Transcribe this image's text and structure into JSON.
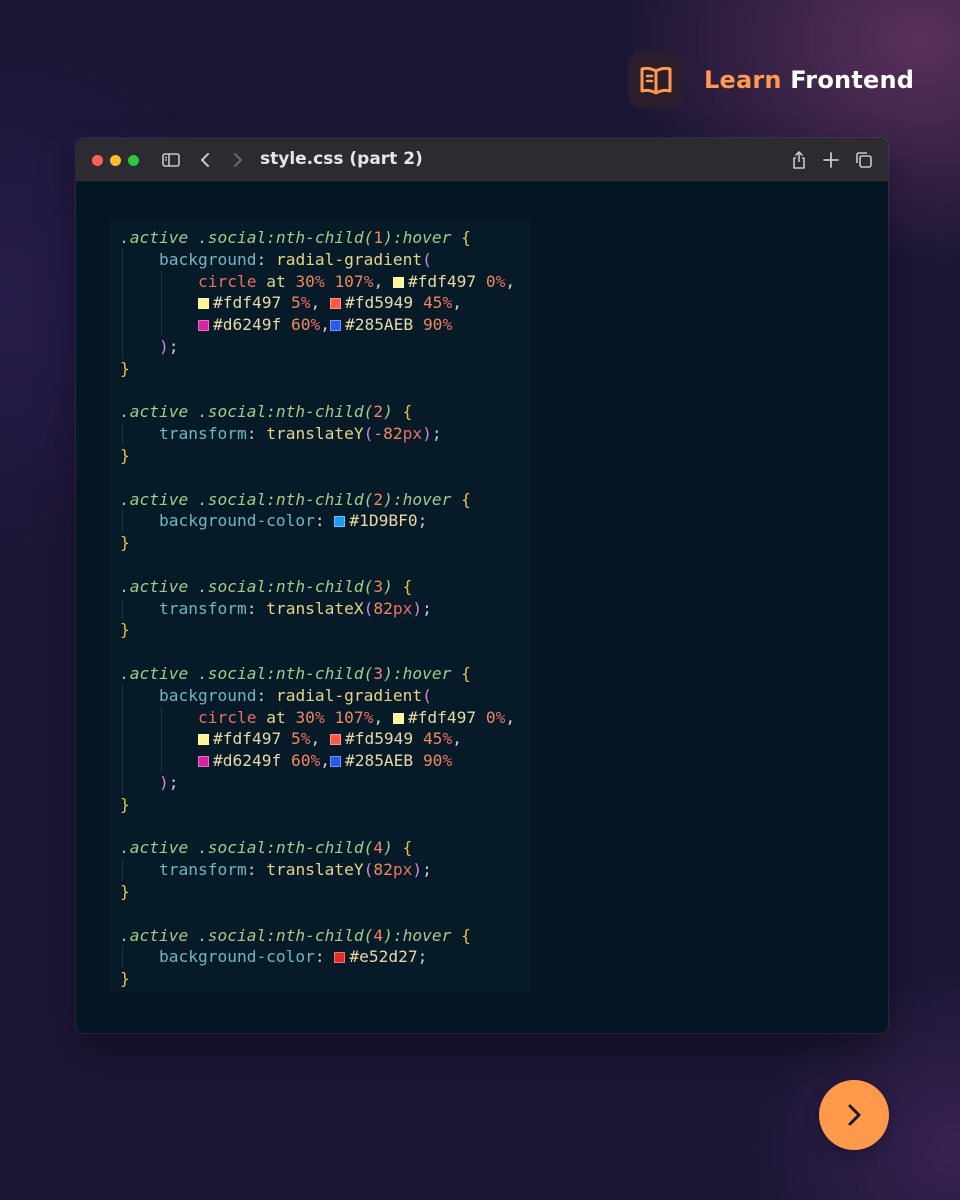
{
  "brand": {
    "name_part1": "Learn",
    "name_part2": "Frontend",
    "logo_icon": "open-book-icon",
    "accent_color": "#ff9a4d"
  },
  "window": {
    "title": "style.css (part 2)",
    "toolbar_icons": [
      "sidebar-icon",
      "back-chevron-icon",
      "forward-chevron-icon",
      "share-icon",
      "plus-icon",
      "copy-tabs-icon"
    ]
  },
  "code": [
    [
      {
        "c": "sel",
        "t": ".active .social:nth-child("
      },
      {
        "c": "num",
        "t": "1"
      },
      {
        "c": "sel",
        "t": "):hover "
      },
      {
        "c": "br",
        "t": "{"
      }
    ],
    [
      {
        "c": "ind",
        "t": "    "
      },
      {
        "c": "prop",
        "t": "background"
      },
      {
        "c": "punc",
        "t": ": "
      },
      {
        "c": "fn",
        "t": "radial-gradient"
      },
      {
        "c": "par",
        "t": "("
      }
    ],
    [
      {
        "c": "ind",
        "t": "        "
      },
      {
        "c": "kw",
        "t": "circle"
      },
      {
        "c": "fn",
        "t": " at "
      },
      {
        "c": "num",
        "t": "30"
      },
      {
        "c": "unit",
        "t": "%"
      },
      {
        "c": "punc",
        "t": " "
      },
      {
        "c": "num",
        "t": "107"
      },
      {
        "c": "unit",
        "t": "%"
      },
      {
        "c": "punc",
        "t": ", "
      },
      {
        "c": "hex",
        "t": "#fdf497",
        "sw": "#fdf497"
      },
      {
        "c": "punc",
        "t": " "
      },
      {
        "c": "num",
        "t": "0"
      },
      {
        "c": "unit",
        "t": "%"
      },
      {
        "c": "punc",
        "t": ","
      }
    ],
    [
      {
        "c": "ind",
        "t": "        "
      },
      {
        "c": "hex",
        "t": "#fdf497",
        "sw": "#fdf497"
      },
      {
        "c": "punc",
        "t": " "
      },
      {
        "c": "num",
        "t": "5"
      },
      {
        "c": "unit",
        "t": "%"
      },
      {
        "c": "punc",
        "t": ", "
      },
      {
        "c": "hex",
        "t": "#fd5949",
        "sw": "#fd5949"
      },
      {
        "c": "punc",
        "t": " "
      },
      {
        "c": "num",
        "t": "45"
      },
      {
        "c": "unit",
        "t": "%"
      },
      {
        "c": "punc",
        "t": ","
      }
    ],
    [
      {
        "c": "ind",
        "t": "        "
      },
      {
        "c": "hex",
        "t": "#d6249f",
        "sw": "#d6249f"
      },
      {
        "c": "punc",
        "t": " "
      },
      {
        "c": "num",
        "t": "60"
      },
      {
        "c": "unit",
        "t": "%"
      },
      {
        "c": "punc",
        "t": ","
      },
      {
        "c": "hex",
        "t": "#285AEB",
        "sw": "#285AEB"
      },
      {
        "c": "punc",
        "t": " "
      },
      {
        "c": "num",
        "t": "90"
      },
      {
        "c": "unit",
        "t": "%"
      }
    ],
    [
      {
        "c": "ind",
        "t": "    "
      },
      {
        "c": "par",
        "t": ")"
      },
      {
        "c": "punc",
        "t": ";"
      }
    ],
    [
      {
        "c": "br",
        "t": "}"
      }
    ],
    [],
    [
      {
        "c": "sel",
        "t": ".active .social:nth-child("
      },
      {
        "c": "num",
        "t": "2"
      },
      {
        "c": "sel",
        "t": ") "
      },
      {
        "c": "br",
        "t": "{"
      }
    ],
    [
      {
        "c": "ind",
        "t": "    "
      },
      {
        "c": "prop",
        "t": "transform"
      },
      {
        "c": "punc",
        "t": ": "
      },
      {
        "c": "fn",
        "t": "translateY"
      },
      {
        "c": "par",
        "t": "("
      },
      {
        "c": "num",
        "t": "-82"
      },
      {
        "c": "unit",
        "t": "px"
      },
      {
        "c": "par",
        "t": ")"
      },
      {
        "c": "punc",
        "t": ";"
      }
    ],
    [
      {
        "c": "br",
        "t": "}"
      }
    ],
    [],
    [
      {
        "c": "sel",
        "t": ".active .social:nth-child("
      },
      {
        "c": "num",
        "t": "2"
      },
      {
        "c": "sel",
        "t": "):hover "
      },
      {
        "c": "br",
        "t": "{"
      }
    ],
    [
      {
        "c": "ind",
        "t": "    "
      },
      {
        "c": "prop",
        "t": "background-color"
      },
      {
        "c": "punc",
        "t": ": "
      },
      {
        "c": "hex",
        "t": "#1D9BF0",
        "sw": "#1D9BF0"
      },
      {
        "c": "punc",
        "t": ";"
      }
    ],
    [
      {
        "c": "br",
        "t": "}"
      }
    ],
    [],
    [
      {
        "c": "sel",
        "t": ".active .social:nth-child("
      },
      {
        "c": "num",
        "t": "3"
      },
      {
        "c": "sel",
        "t": ") "
      },
      {
        "c": "br",
        "t": "{"
      }
    ],
    [
      {
        "c": "ind",
        "t": "    "
      },
      {
        "c": "prop",
        "t": "transform"
      },
      {
        "c": "punc",
        "t": ": "
      },
      {
        "c": "fn",
        "t": "translateX"
      },
      {
        "c": "par",
        "t": "("
      },
      {
        "c": "num",
        "t": "82"
      },
      {
        "c": "unit",
        "t": "px"
      },
      {
        "c": "par",
        "t": ")"
      },
      {
        "c": "punc",
        "t": ";"
      }
    ],
    [
      {
        "c": "br",
        "t": "}"
      }
    ],
    [],
    [
      {
        "c": "sel",
        "t": ".active .social:nth-child("
      },
      {
        "c": "num",
        "t": "3"
      },
      {
        "c": "sel",
        "t": "):hover "
      },
      {
        "c": "br",
        "t": "{"
      }
    ],
    [
      {
        "c": "ind",
        "t": "    "
      },
      {
        "c": "prop",
        "t": "background"
      },
      {
        "c": "punc",
        "t": ": "
      },
      {
        "c": "fn",
        "t": "radial-gradient"
      },
      {
        "c": "par",
        "t": "("
      }
    ],
    [
      {
        "c": "ind",
        "t": "        "
      },
      {
        "c": "kw",
        "t": "circle"
      },
      {
        "c": "fn",
        "t": " at "
      },
      {
        "c": "num",
        "t": "30"
      },
      {
        "c": "unit",
        "t": "%"
      },
      {
        "c": "punc",
        "t": " "
      },
      {
        "c": "num",
        "t": "107"
      },
      {
        "c": "unit",
        "t": "%"
      },
      {
        "c": "punc",
        "t": ", "
      },
      {
        "c": "hex",
        "t": "#fdf497",
        "sw": "#fdf497"
      },
      {
        "c": "punc",
        "t": " "
      },
      {
        "c": "num",
        "t": "0"
      },
      {
        "c": "unit",
        "t": "%"
      },
      {
        "c": "punc",
        "t": ","
      }
    ],
    [
      {
        "c": "ind",
        "t": "        "
      },
      {
        "c": "hex",
        "t": "#fdf497",
        "sw": "#fdf497"
      },
      {
        "c": "punc",
        "t": " "
      },
      {
        "c": "num",
        "t": "5"
      },
      {
        "c": "unit",
        "t": "%"
      },
      {
        "c": "punc",
        "t": ", "
      },
      {
        "c": "hex",
        "t": "#fd5949",
        "sw": "#fd5949"
      },
      {
        "c": "punc",
        "t": " "
      },
      {
        "c": "num",
        "t": "45"
      },
      {
        "c": "unit",
        "t": "%"
      },
      {
        "c": "punc",
        "t": ","
      }
    ],
    [
      {
        "c": "ind",
        "t": "        "
      },
      {
        "c": "hex",
        "t": "#d6249f",
        "sw": "#d6249f"
      },
      {
        "c": "punc",
        "t": " "
      },
      {
        "c": "num",
        "t": "60"
      },
      {
        "c": "unit",
        "t": "%"
      },
      {
        "c": "punc",
        "t": ","
      },
      {
        "c": "hex",
        "t": "#285AEB",
        "sw": "#285AEB"
      },
      {
        "c": "punc",
        "t": " "
      },
      {
        "c": "num",
        "t": "90"
      },
      {
        "c": "unit",
        "t": "%"
      }
    ],
    [
      {
        "c": "ind",
        "t": "    "
      },
      {
        "c": "par",
        "t": ")"
      },
      {
        "c": "punc",
        "t": ";"
      }
    ],
    [
      {
        "c": "br",
        "t": "}"
      }
    ],
    [],
    [
      {
        "c": "sel",
        "t": ".active .social:nth-child("
      },
      {
        "c": "num",
        "t": "4"
      },
      {
        "c": "sel",
        "t": ") "
      },
      {
        "c": "br",
        "t": "{"
      }
    ],
    [
      {
        "c": "ind",
        "t": "    "
      },
      {
        "c": "prop",
        "t": "transform"
      },
      {
        "c": "punc",
        "t": ": "
      },
      {
        "c": "fn",
        "t": "translateY"
      },
      {
        "c": "par",
        "t": "("
      },
      {
        "c": "num",
        "t": "82"
      },
      {
        "c": "unit",
        "t": "px"
      },
      {
        "c": "par",
        "t": ")"
      },
      {
        "c": "punc",
        "t": ";"
      }
    ],
    [
      {
        "c": "br",
        "t": "}"
      }
    ],
    [],
    [
      {
        "c": "sel",
        "t": ".active .social:nth-child("
      },
      {
        "c": "num",
        "t": "4"
      },
      {
        "c": "sel",
        "t": "):hover "
      },
      {
        "c": "br",
        "t": "{"
      }
    ],
    [
      {
        "c": "ind",
        "t": "    "
      },
      {
        "c": "prop",
        "t": "background-color"
      },
      {
        "c": "punc",
        "t": ": "
      },
      {
        "c": "hex",
        "t": "#e52d27",
        "sw": "#e52d27"
      },
      {
        "c": "punc",
        "t": ";"
      }
    ],
    [
      {
        "c": "br",
        "t": "}"
      }
    ]
  ],
  "next_button": {
    "icon": "chevron-right-icon"
  }
}
